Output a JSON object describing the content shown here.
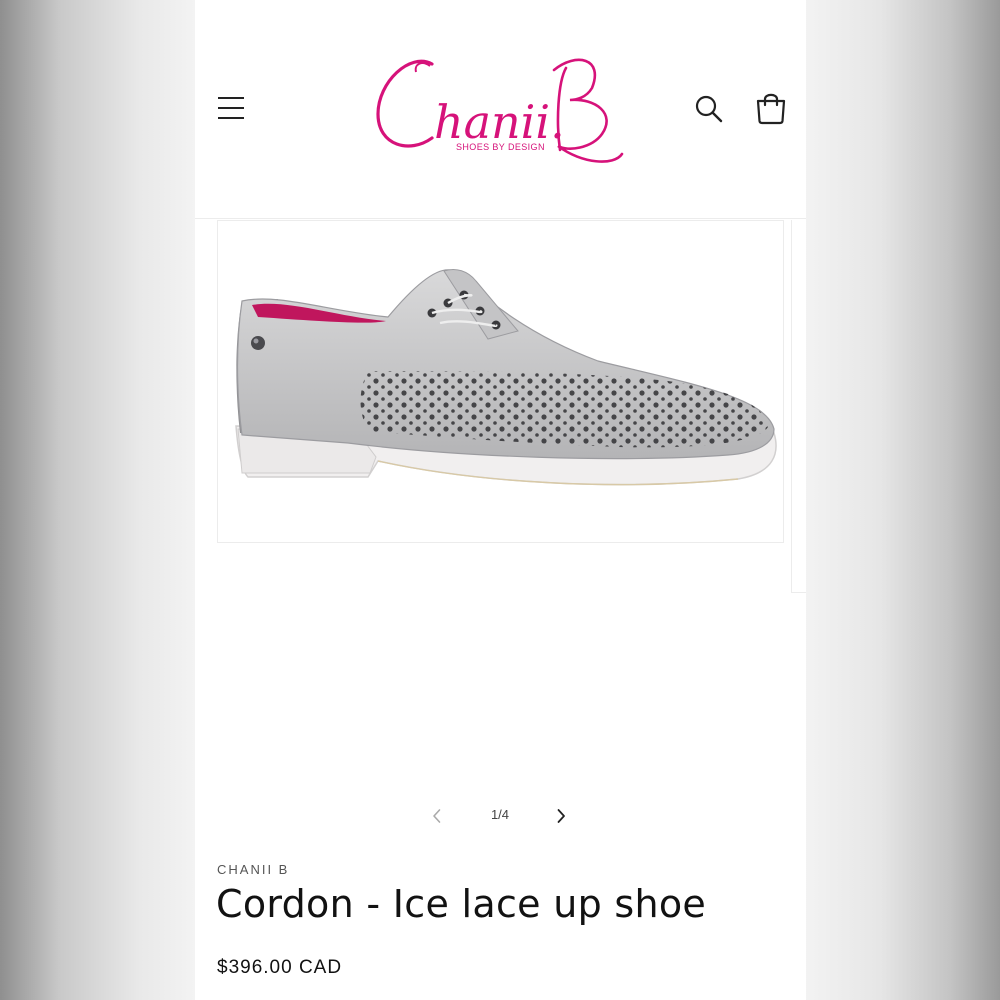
{
  "header": {
    "menu_icon": "hamburger-menu-icon",
    "logo": {
      "wordmark": "Chanii.B",
      "tagline": "SHOES BY DESIGN",
      "color": "#d6127a"
    },
    "search_icon": "search-icon",
    "cart_icon": "shopping-bag-icon"
  },
  "product": {
    "vendor": "CHANII B",
    "title": "Cordon - Ice lace up shoe",
    "price": "$396.00 CAD",
    "image_alt": "Light grey perforated leather lace-up shoe with white sole"
  },
  "gallery": {
    "counter": "1/4",
    "prev_icon": "chevron-left-icon",
    "next_icon": "chevron-right-icon"
  }
}
